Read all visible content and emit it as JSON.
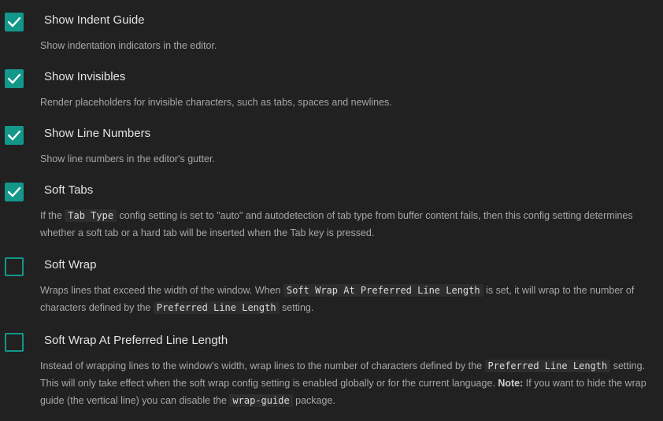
{
  "settings": [
    {
      "title": "Show Indent Guide",
      "checked": true,
      "description": "Show indentation indicators in the editor."
    },
    {
      "title": "Show Invisibles",
      "checked": true,
      "description": "Render placeholders for invisible characters, such as tabs, spaces and newlines."
    },
    {
      "title": "Show Line Numbers",
      "checked": true,
      "description": "Show line numbers in the editor's gutter."
    },
    {
      "title": "Soft Tabs",
      "checked": true,
      "desc_parts": {
        "a": "If the ",
        "code1": "Tab Type",
        "b": " config setting is set to \"auto\" and autodetection of tab type from buffer content fails, then this config setting determines whether a soft tab or a hard tab will be inserted when the Tab key is pressed."
      }
    },
    {
      "title": "Soft Wrap",
      "checked": false,
      "desc_parts": {
        "a": "Wraps lines that exceed the width of the window. When ",
        "code1": "Soft Wrap At Preferred Line Length",
        "b": " is set, it will wrap to the number of characters defined by the ",
        "code2": "Preferred Line Length",
        "c": " setting."
      }
    },
    {
      "title": "Soft Wrap At Preferred Line Length",
      "checked": false,
      "desc_parts": {
        "a": "Instead of wrapping lines to the window's width, wrap lines to the number of characters defined by the ",
        "code1": "Preferred Line Length",
        "b": " setting. This will only take effect when the soft wrap config setting is enabled globally or for the current language. ",
        "note": "Note:",
        "c": " If you want to hide the wrap guide (the vertical line) you can disable the ",
        "code2": "wrap-guide",
        "d": " package."
      }
    }
  ],
  "colors": {
    "background": "#212121",
    "accent": "#12978a"
  }
}
